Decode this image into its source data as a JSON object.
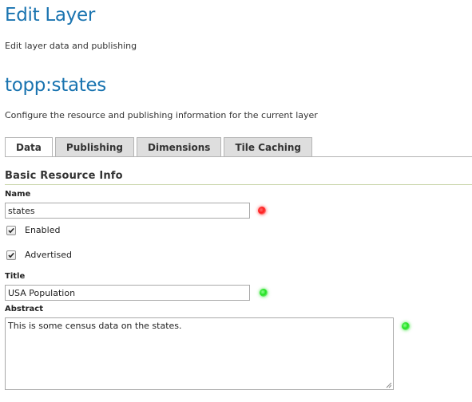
{
  "header": {
    "title": "Edit Layer",
    "subtitle": "Edit layer data and publishing"
  },
  "layer": {
    "name": "topp:states",
    "description": "Configure the resource and publishing information for the current layer"
  },
  "tabs": [
    {
      "label": "Data",
      "active": true
    },
    {
      "label": "Publishing",
      "active": false
    },
    {
      "label": "Dimensions",
      "active": false
    },
    {
      "label": "Tile Caching",
      "active": false
    }
  ],
  "section": {
    "title": "Basic Resource Info"
  },
  "form": {
    "name_label": "Name",
    "name_value": "states",
    "enabled_label": "Enabled",
    "enabled_checked": true,
    "advertised_label": "Advertised",
    "advertised_checked": true,
    "title_label": "Title",
    "title_value": "USA Population",
    "abstract_label": "Abstract",
    "abstract_value": "This is some census data on the states."
  },
  "colors": {
    "heading": "#1a74b0",
    "status_error": "#ff1a1a",
    "status_ok": "#1fe01f"
  }
}
